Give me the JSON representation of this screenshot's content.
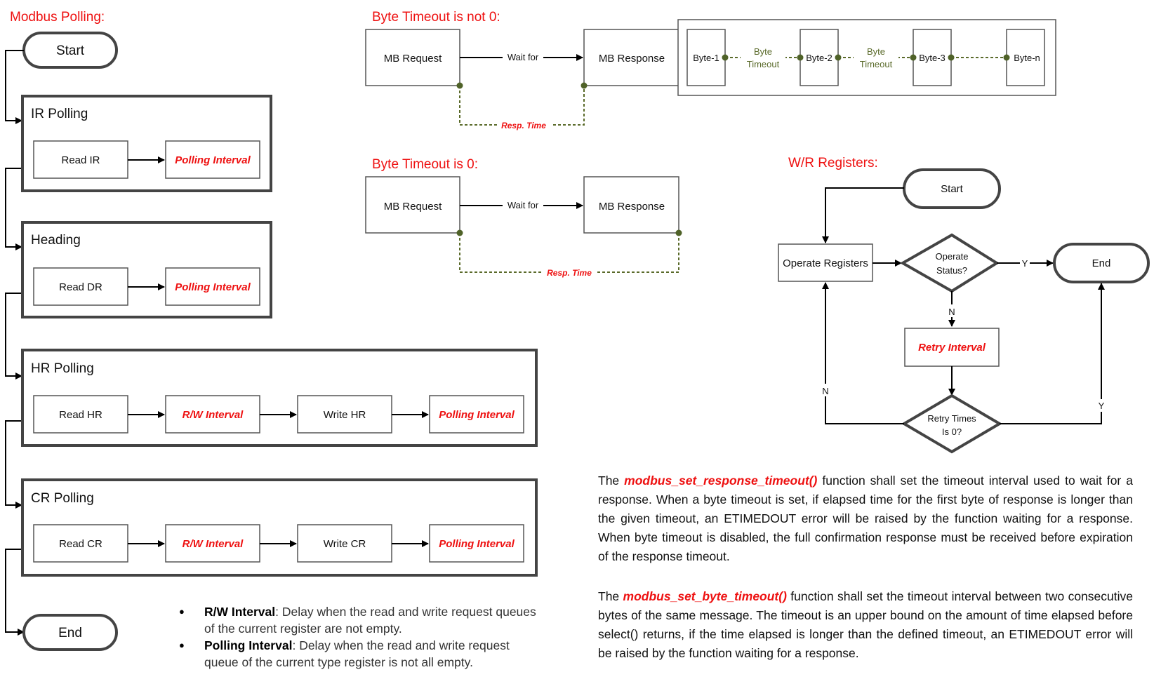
{
  "modbus_polling": {
    "title": "Modbus Polling:",
    "start": "Start",
    "end": "End",
    "groups": [
      {
        "title": "IR Polling",
        "steps": [
          {
            "label": "Read IR",
            "highlight": false
          },
          {
            "label": "Polling Interval",
            "highlight": true
          }
        ]
      },
      {
        "title": "Heading",
        "steps": [
          {
            "label": "Read DR",
            "highlight": false
          },
          {
            "label": "Polling Interval",
            "highlight": true
          }
        ]
      },
      {
        "title": "HR Polling",
        "steps": [
          {
            "label": "Read HR",
            "highlight": false
          },
          {
            "label": "R/W Interval",
            "highlight": true
          },
          {
            "label": "Write HR",
            "highlight": false
          },
          {
            "label": "Polling Interval",
            "highlight": true
          }
        ]
      },
      {
        "title": "CR Polling",
        "steps": [
          {
            "label": "Read CR",
            "highlight": false
          },
          {
            "label": "R/W Interval",
            "highlight": true
          },
          {
            "label": "Write CR",
            "highlight": false
          },
          {
            "label": "Polling Interval",
            "highlight": true
          }
        ]
      }
    ],
    "notes": [
      {
        "term": "R/W Interval",
        "sep": ":  ",
        "text": "Delay when the read and write request queues of the current register are not empty."
      },
      {
        "term": "Polling Interval",
        "sep": ":  ",
        "text": "Delay when the read and write request queue of the current type register is not all empty."
      }
    ]
  },
  "byte_timeout_not_zero": {
    "title": "Byte Timeout is not 0:",
    "request": "MB  Request",
    "response": "MB Response",
    "arrow_label": "Wait for",
    "resp_time": "Resp. Time",
    "bytes": [
      "Byte-1",
      "Byte-2",
      "Byte-3",
      "Byte-n"
    ],
    "byte_timeout_label_1": "Byte",
    "byte_timeout_label_2": "Timeout"
  },
  "byte_timeout_zero": {
    "title": "Byte Timeout is 0:",
    "request": "MB  Request",
    "response": "MB Response",
    "arrow_label": "Wait for",
    "resp_time": "Resp. Time"
  },
  "wr_registers": {
    "title": "W/R Registers:",
    "start": "Start",
    "operate": "Operate Registers",
    "decision1_line1": "Operate",
    "decision1_line2": "Status?",
    "yes": "Y",
    "no": "N",
    "end": "End",
    "retry_interval": "Retry Interval",
    "decision2_line1": "Retry Times",
    "decision2_line2": "Is 0?"
  },
  "descriptions": [
    {
      "prefix": "The ",
      "function": "modbus_set_response_timeout()",
      "text": " function shall set the timeout interval used to wait for a response. When a byte timeout is set, if elapsed time for the first byte of response is longer than the given timeout, an ETIMEDOUT error will be raised by the function waiting for a response. When byte timeout is disabled, the full confirmation response must be received before expiration of the response timeout."
    },
    {
      "prefix": "The ",
      "function": "modbus_set_byte_timeout()",
      "text": " function shall set the timeout interval between two consecutive bytes of the same message. The timeout is an upper bound on the amount of time elapsed before select() returns, if the time elapsed is longer than the defined timeout, an ETIMEDOUT error will be raised by the function waiting for a response."
    }
  ]
}
